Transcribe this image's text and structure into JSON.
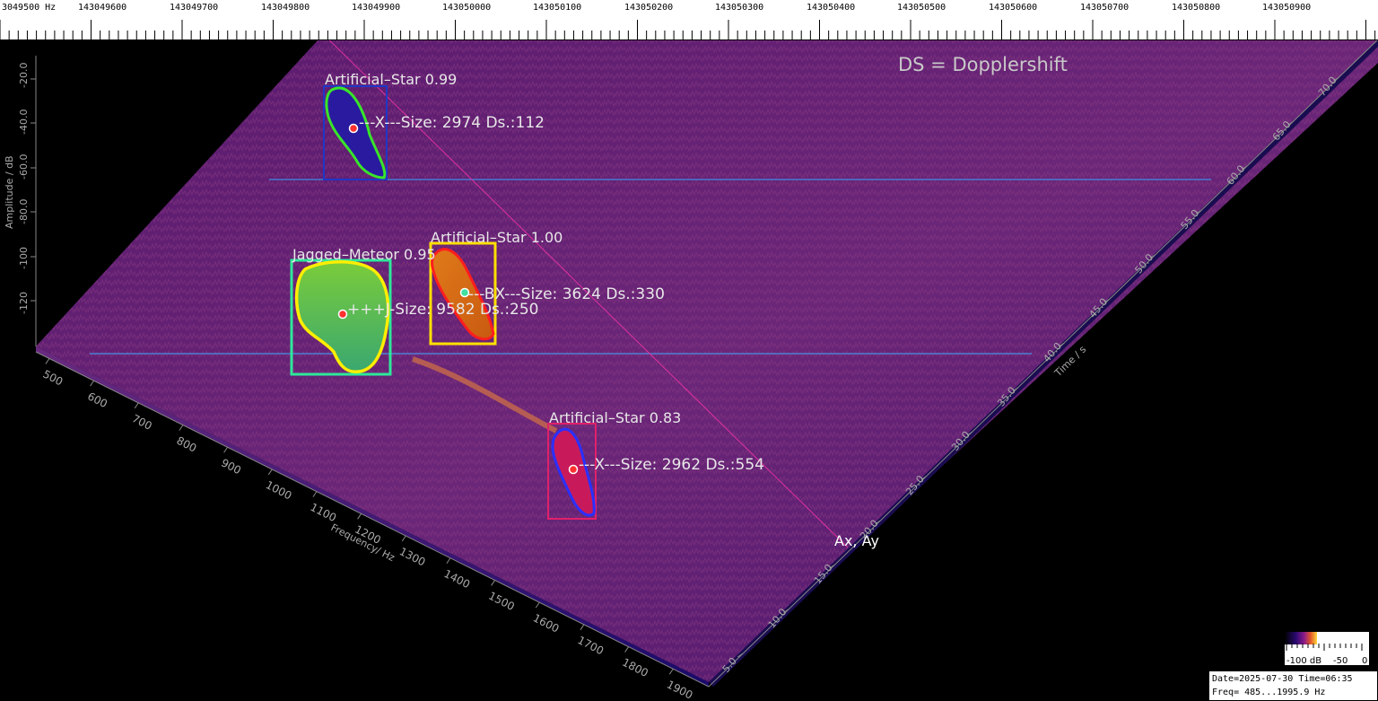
{
  "ruler": {
    "labels": [
      "3049500 Hz",
      "143049600",
      "143049700",
      "143049800",
      "143049900",
      "143050000",
      "143050100",
      "143050200",
      "143050300",
      "143050400",
      "143050500",
      "143050600",
      "143050700",
      "143050800",
      "143050900"
    ]
  },
  "annotations": {
    "ds_note": "DS = Dopplershift",
    "ax_label": "Ax, Ay",
    "detections": [
      {
        "label": "Artificial–Star 0.99",
        "size_text": "---X---Size: 2974 Ds.:112",
        "box_color": "#1f36c8",
        "contour_color": "#38e62a"
      },
      {
        "label": "Artificial–Star 1.00",
        "size_text": "---BX---Size: 3624 Ds.:330",
        "box_color": "#ffe000",
        "contour_color": "#ff1e1e"
      },
      {
        "label": "Jagged–Meteor 0.95",
        "size_text": "+++J-Size: 9582 Ds.:250",
        "box_color": "#2ee89a",
        "contour_color": "#ffee00"
      },
      {
        "label": "Artificial–Star 0.83",
        "size_text": "---X---Size: 2962 Ds.:554",
        "box_color": "#e0206a",
        "contour_color": "#2a30ff"
      }
    ]
  },
  "axes": {
    "amplitude_label": "Amplitude / dB",
    "amplitude_ticks": [
      "-20.0",
      "-40.0",
      "-60.0",
      "-80.0",
      "-100",
      "-120"
    ],
    "frequency_label": "Frequency/ Hz",
    "frequency_ticks": [
      "500",
      "600",
      "700",
      "800",
      "900",
      "1000",
      "1100",
      "1200",
      "1300",
      "1400",
      "1500",
      "1600",
      "1700",
      "1800",
      "1900"
    ],
    "time_label": "Time / s",
    "time_ticks": [
      "5.0",
      "10.0",
      "15.0",
      "20.0",
      "25.0",
      "30.0",
      "35.0",
      "40.0",
      "45.0",
      "50.0",
      "55.0",
      "60.0",
      "65.0",
      "70.0"
    ]
  },
  "colorbar": {
    "labels": [
      "-100 dB",
      "-50",
      "0"
    ]
  },
  "info": {
    "line1": "Date=2025-07-30 Time=06:35",
    "line2": "Freq= 485...1995.9 Hz"
  },
  "colors": {
    "surface_dark": "#3a1060",
    "surface_mid": "#6a2278",
    "surface_light": "#8a3a7a",
    "guide_blue": "#3aa8ff",
    "diagonal": "#e030a0"
  }
}
